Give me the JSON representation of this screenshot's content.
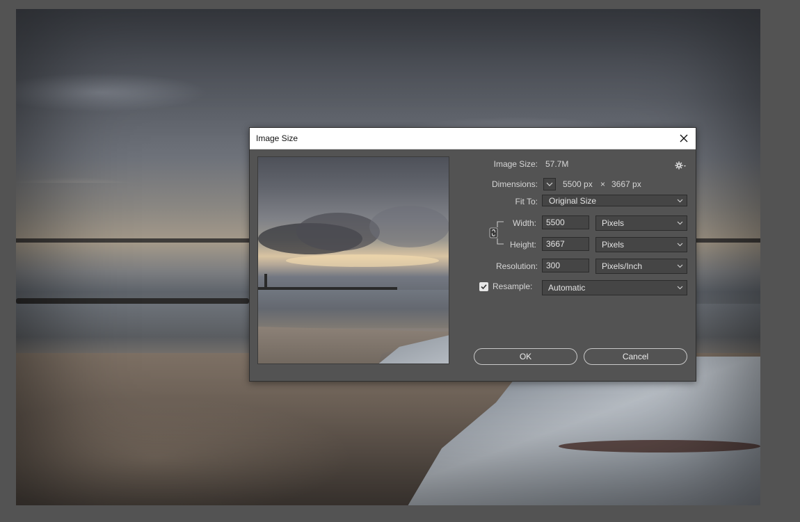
{
  "dialog": {
    "title": "Image Size",
    "image_size_label": "Image Size:",
    "image_size_value": "57.7M",
    "dimensions_label": "Dimensions:",
    "dimensions_width": "5500 px",
    "dimensions_times": "×",
    "dimensions_height": "3667 px",
    "fit_to_label": "Fit To:",
    "fit_to_value": "Original Size",
    "width_label": "Width:",
    "width_value": "5500",
    "width_unit": "Pixels",
    "height_label": "Height:",
    "height_value": "3667",
    "height_unit": "Pixels",
    "resolution_label": "Resolution:",
    "resolution_value": "300",
    "resolution_unit": "Pixels/Inch",
    "resample_label": "Resample:",
    "resample_checked": true,
    "resample_value": "Automatic",
    "ok_label": "OK",
    "cancel_label": "Cancel"
  },
  "icons": {
    "close": "close-icon",
    "gear": "gear-icon",
    "chevron": "chevron-down-icon",
    "link": "link-icon",
    "check": "checkmark-icon"
  },
  "colors": {
    "workspace": "#535353",
    "dialog_bg": "#535353",
    "field_bg": "#454545",
    "text": "#d6d6d6",
    "titlebar": "#ffffff"
  }
}
